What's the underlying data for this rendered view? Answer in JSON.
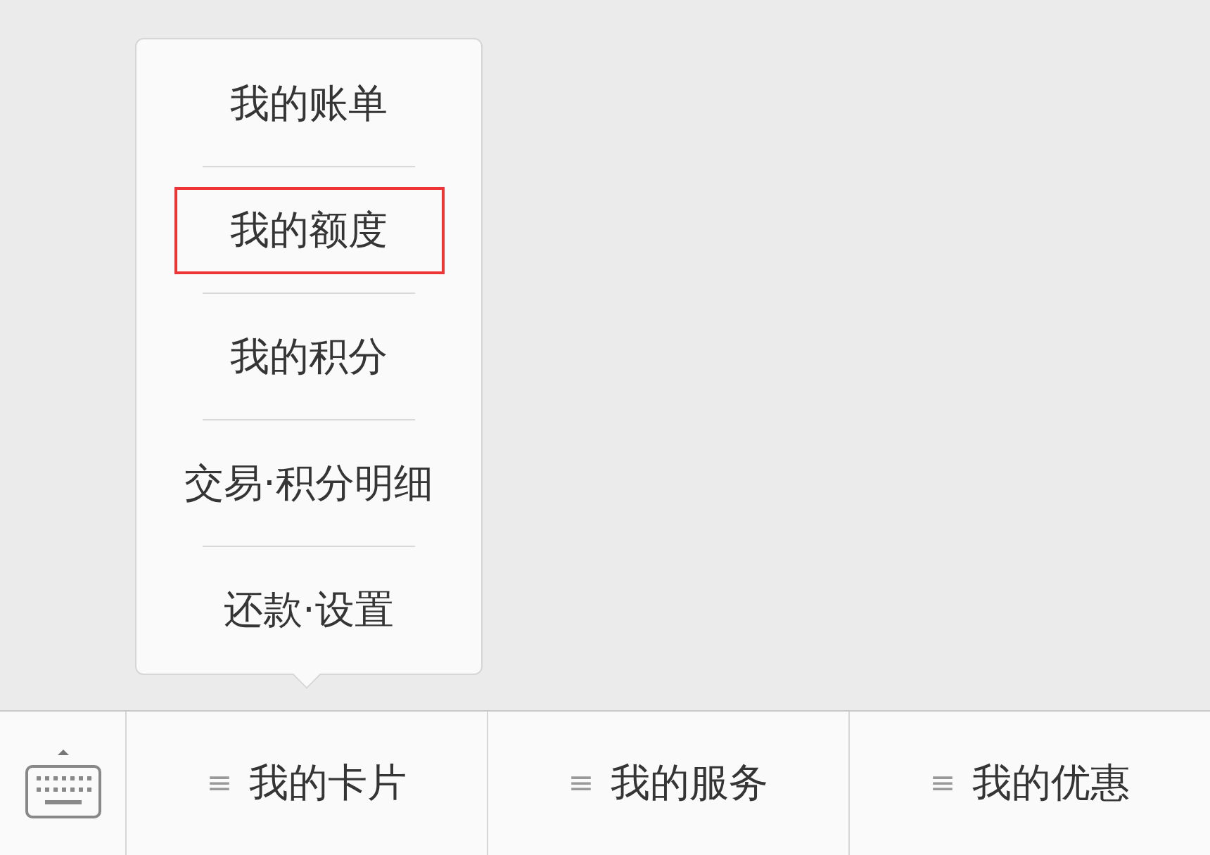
{
  "popup_menu": {
    "items": [
      {
        "label": "我的账单",
        "highlighted": false
      },
      {
        "label": "我的额度",
        "highlighted": true
      },
      {
        "label": "我的积分",
        "highlighted": false
      },
      {
        "label": "交易·积分明细",
        "highlighted": false
      },
      {
        "label": "还款·设置",
        "highlighted": false
      }
    ]
  },
  "bottom_bar": {
    "menus": [
      {
        "icon": "≡",
        "label": "我的卡片"
      },
      {
        "icon": "≡",
        "label": "我的服务"
      },
      {
        "icon": "≡",
        "label": "我的优惠"
      }
    ]
  }
}
